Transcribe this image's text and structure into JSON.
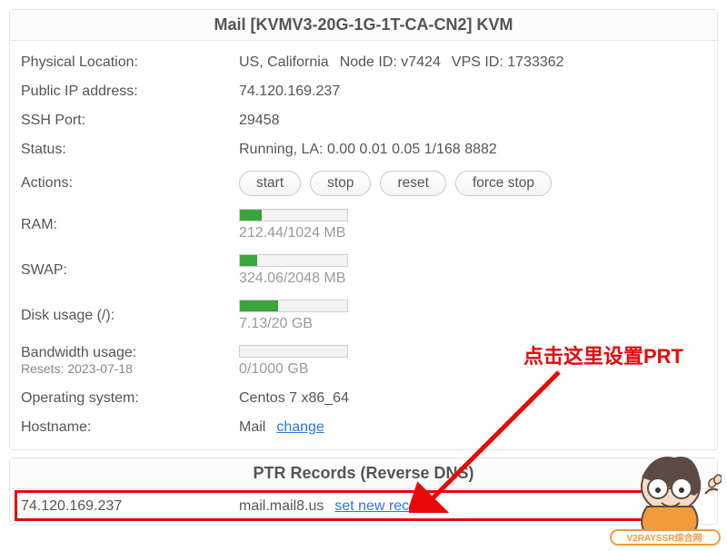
{
  "header": {
    "title": "Mail   [KVMV3-20G-1G-1T-CA-CN2]   KVM"
  },
  "info": {
    "phys_loc_label": "Physical Location:",
    "phys_loc_value": "US, California",
    "node_label": "Node ID: v7424",
    "vps_label": "VPS ID: 1733362",
    "pub_ip_label": "Public IP address:",
    "pub_ip_value": "74.120.169.237",
    "ssh_label": "SSH Port:",
    "ssh_value": "29458",
    "status_label": "Status:",
    "status_value": "Running, LA: 0.00 0.01 0.05 1/168 8882",
    "actions_label": "Actions:",
    "actions": {
      "start": "start",
      "stop": "stop",
      "reset": "reset",
      "force_stop": "force stop"
    },
    "ram_label": "RAM:",
    "ram_used": 212.44,
    "ram_total": 1024,
    "ram_text": "212.44/1024 MB",
    "swap_label": "SWAP:",
    "swap_used": 324.06,
    "swap_total": 2048,
    "swap_text": "324.06/2048 MB",
    "disk_label": "Disk usage (/):",
    "disk_used": 7.13,
    "disk_total": 20,
    "disk_text": "7.13/20 GB",
    "bw_label": "Bandwidth usage:",
    "bw_reset": "Resets: 2023-07-18",
    "bw_used": 0,
    "bw_total": 1000,
    "bw_text": "0/1000 GB",
    "os_label": "Operating system:",
    "os_value": "Centos 7 x86_64",
    "hostname_label": "Hostname:",
    "hostname_value": "Mail",
    "change_label": "change"
  },
  "ptr": {
    "heading": "PTR Records (Reverse DNS)",
    "ip": "74.120.169.237",
    "host": "mail.mail8.us",
    "set_label": "set new record"
  },
  "annotation": {
    "text": "点击这里设置PRT"
  },
  "watermark": "V2RAYSSR综合网"
}
